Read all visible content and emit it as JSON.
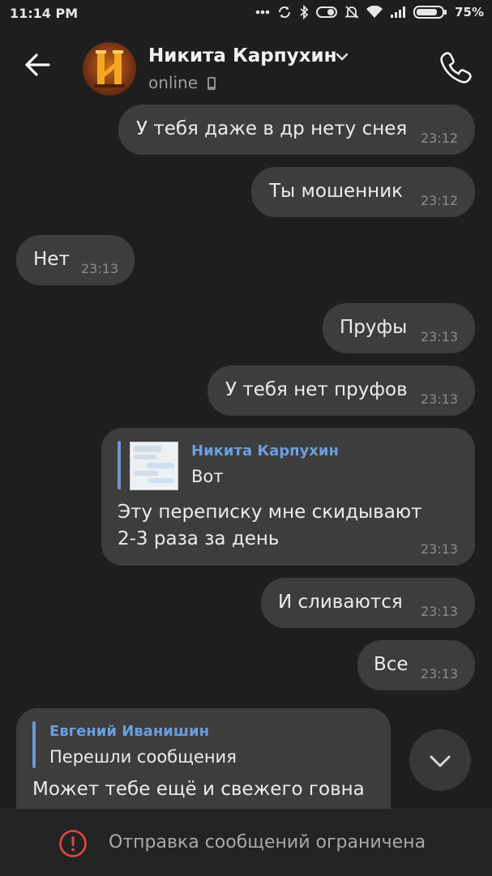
{
  "status_bar": {
    "time": "11:14 PM",
    "battery_percent": "75%",
    "icons": [
      "dots-icon",
      "sync-icon",
      "bluetooth-icon",
      "toggle-icon",
      "mute-icon",
      "wifi-icon",
      "signal-icon",
      "battery-icon"
    ]
  },
  "header": {
    "contact_name": "Никита Карпухин",
    "status": "online",
    "avatar_letter": "H",
    "colors": {
      "background": "#1e1e1e",
      "bubble": "#3d3d3d",
      "accent": "#6b97d6"
    }
  },
  "messages": [
    {
      "text": "У тебя даже в др нету снея",
      "time": "23:12",
      "direction": "outgoing"
    },
    {
      "text": "Ты мошенник",
      "time": "23:12",
      "direction": "outgoing"
    },
    {
      "text": "Нет",
      "time": "23:13",
      "direction": "incoming"
    },
    {
      "text": "Пруфы",
      "time": "23:13",
      "direction": "outgoing"
    },
    {
      "text": "У тебя нет пруфов",
      "time": "23:13",
      "direction": "outgoing"
    },
    {
      "reply_name": "Никита Карпухин",
      "reply_text": "Вот",
      "text_line1": "Эту переписку мне скидывают",
      "text_line2": "2-3 раза за день",
      "time": "23:13",
      "direction": "outgoing"
    },
    {
      "text": "И сливаются",
      "time": "23:13",
      "direction": "outgoing"
    },
    {
      "text": "Все",
      "time": "23:13",
      "direction": "outgoing"
    },
    {
      "reply_name": "Евгений Иванишин",
      "reply_text": "Перешли сообщения",
      "text": "Может тебе ещё и свежего говна",
      "direction": "incoming"
    }
  ],
  "bottom_bar": {
    "restriction_text": "Отправка сообщений ограничена",
    "icon": "alert-circle-icon",
    "icon_color": "#e04848"
  }
}
